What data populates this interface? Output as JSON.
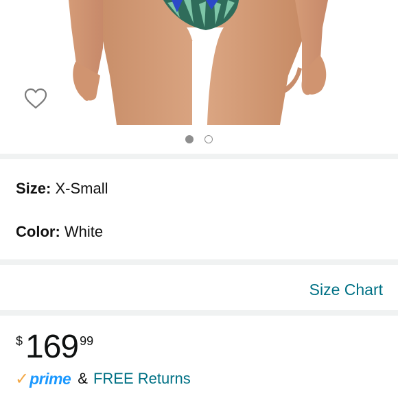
{
  "gallery": {
    "image_alt": "product-photo-bikini-bottom",
    "wishlist_icon": "heart-outline-icon",
    "dots": [
      {
        "active": true
      },
      {
        "active": false
      }
    ]
  },
  "variant": {
    "size_label": "Size:",
    "size_value": "X-Small",
    "color_label": "Color:",
    "color_value": "White"
  },
  "links": {
    "size_chart": "Size Chart"
  },
  "price": {
    "symbol": "$",
    "whole": "169",
    "fraction": "99"
  },
  "delivery": {
    "prime_check": "✓",
    "prime_label": "prime",
    "ampersand": "&",
    "free_returns": "FREE Returns"
  },
  "colors": {
    "link": "#007185",
    "prime_blue": "#1a98ff",
    "prime_orange": "#f3a847",
    "divider": "#f0f2f2"
  }
}
